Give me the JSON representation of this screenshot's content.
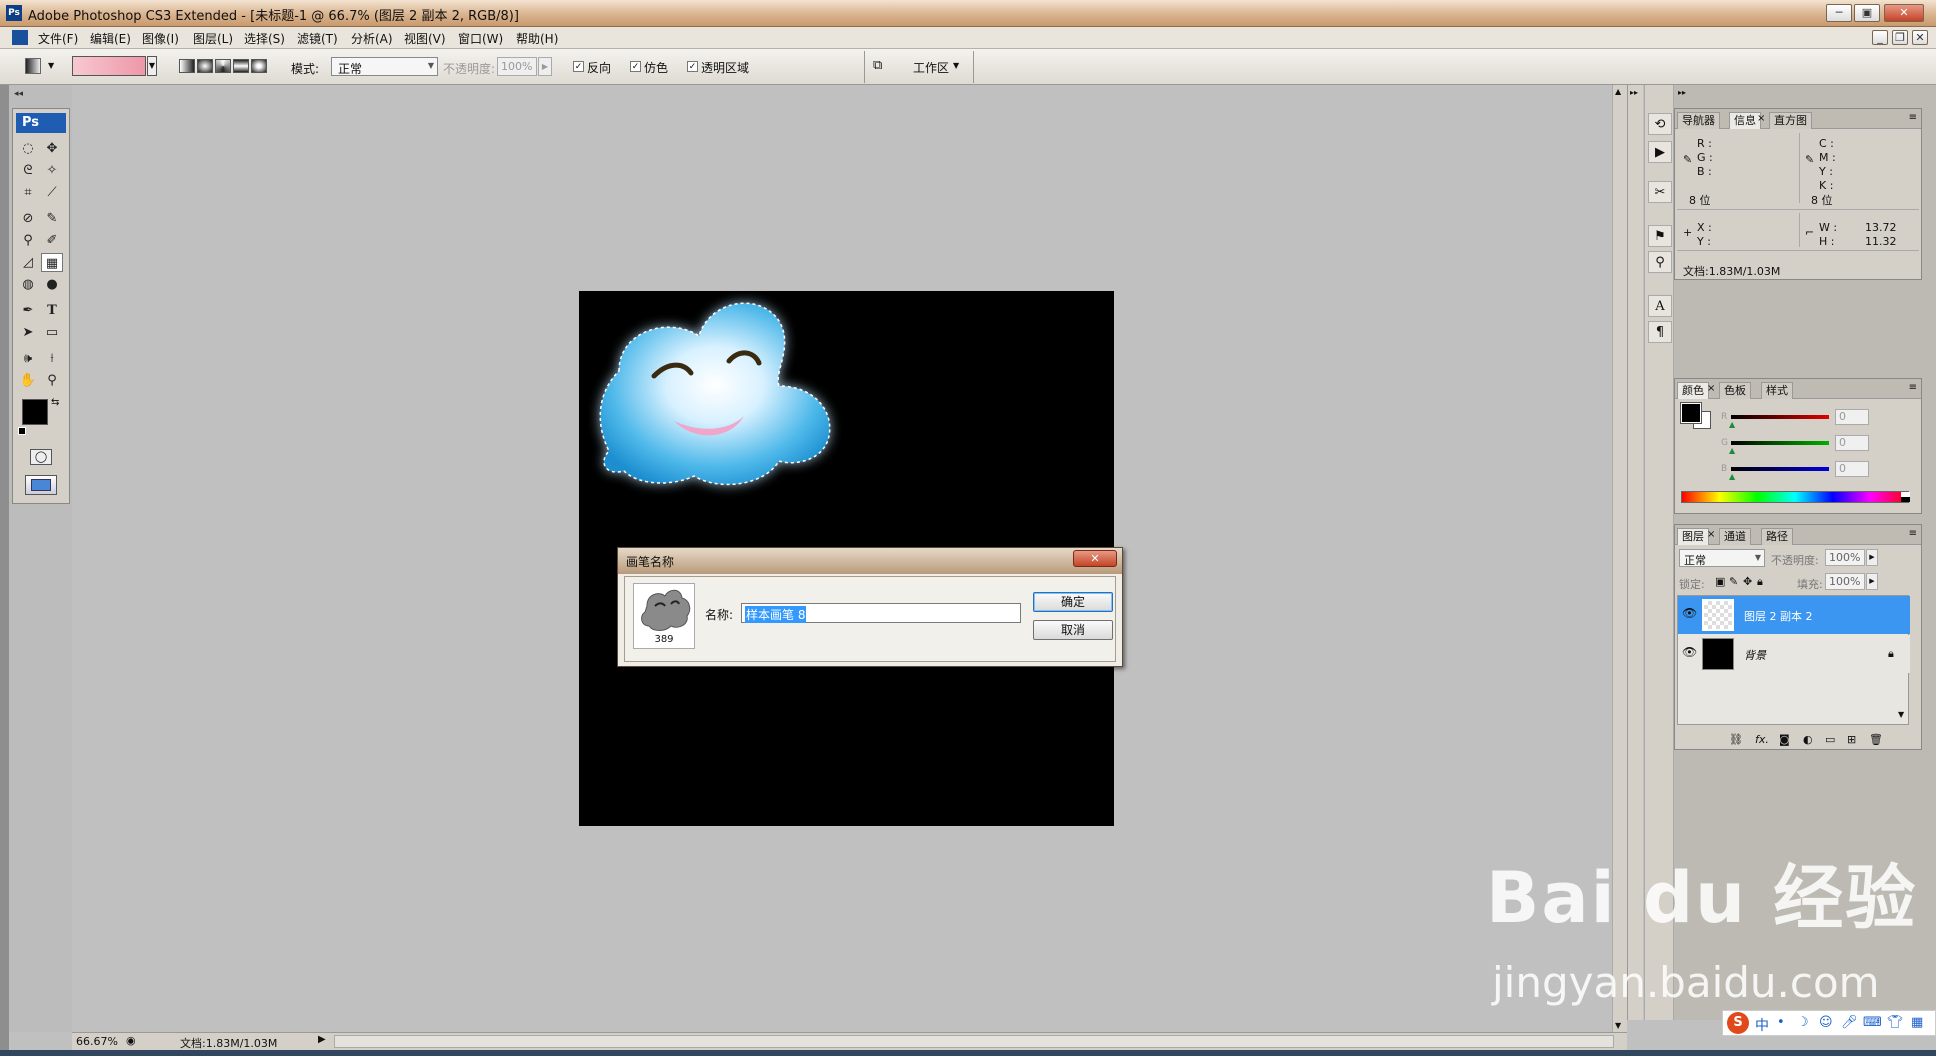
{
  "window": {
    "title": "Adobe Photoshop CS3 Extended - [未标题-1 @ 66.7% (图层 2 副本 2, RGB/8)]",
    "app_badge": "Ps"
  },
  "menu": [
    "文件(F)",
    "编辑(E)",
    "图像(I)",
    "图层(L)",
    "选择(S)",
    "滤镜(T)",
    "分析(A)",
    "视图(V)",
    "窗口(W)",
    "帮助(H)"
  ],
  "options": {
    "mode_label": "模式:",
    "mode_value": "正常",
    "opacity_label": "不透明度:",
    "opacity_value": "100%",
    "reverse_label": "反向",
    "dither_label": "仿色",
    "transparency_label": "透明区域",
    "workspace_label": "工作区"
  },
  "toolbox": {
    "badge": "Ps"
  },
  "info_panel": {
    "tabs": [
      "导航器",
      "信息",
      "直方图"
    ],
    "rgb_labels": [
      "R :",
      "G :",
      "B :"
    ],
    "cmyk_labels": [
      "C :",
      "M :",
      "Y :",
      "K :"
    ],
    "bit_left": "8 位",
    "bit_right": "8 位",
    "xy_labels": [
      "X :",
      "Y :"
    ],
    "w_label": "W :",
    "w_value": "13.72",
    "h_label": "H :",
    "h_value": "11.32",
    "doc": "文档:1.83M/1.03M"
  },
  "color_panel": {
    "tabs": [
      "颜色",
      "色板",
      "样式"
    ],
    "channels": [
      {
        "label": "R",
        "value": "0",
        "color": "#d00000"
      },
      {
        "label": "G",
        "value": "0",
        "color": "#00a000"
      },
      {
        "label": "B",
        "value": "0",
        "color": "#0000c8"
      }
    ]
  },
  "layers_panel": {
    "tabs": [
      "图层",
      "通道",
      "路径"
    ],
    "blend_mode": "正常",
    "opacity_label": "不透明度:",
    "opacity_value": "100%",
    "lock_label": "锁定:",
    "fill_label": "填充:",
    "fill_value": "100%",
    "layers": [
      {
        "name": "图层 2 副本 2",
        "selected": true
      },
      {
        "name": "背景",
        "selected": false
      }
    ]
  },
  "dialog": {
    "title": "画笔名称",
    "brush_size": "389",
    "name_label": "名称:",
    "name_value": "样本画笔 8",
    "ok": "确定",
    "cancel": "取消"
  },
  "status": {
    "zoom": "66.67%",
    "doc": "文档:1.83M/1.03M"
  },
  "watermark": {
    "brand": "Bai du 经验",
    "url": "jingyan.baidu.com"
  },
  "ime": {
    "lang": "中"
  },
  "colors": {
    "accent": "#3399ff",
    "selection_blue": "#3a96f0",
    "canvas_bg": "#000000"
  }
}
